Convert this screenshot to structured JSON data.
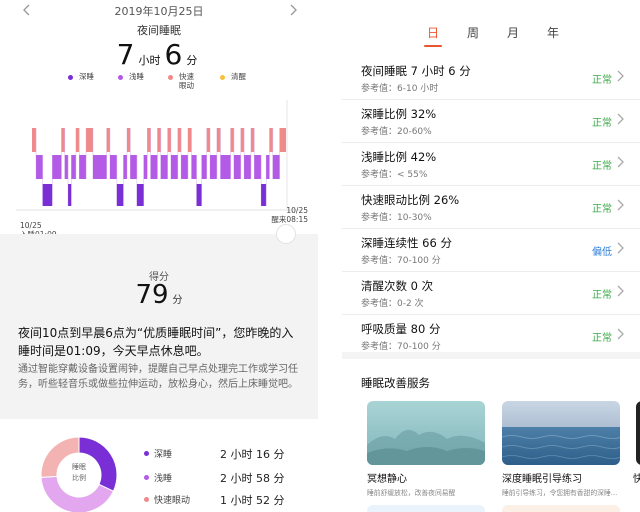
{
  "header": {
    "date": "2019年10月25日",
    "title": "夜间睡眠",
    "hours": "7",
    "hours_unit": "小时",
    "minutes": "6",
    "minutes_unit": "分"
  },
  "legend": [
    {
      "label": "深睡",
      "color": "#7a2fd6"
    },
    {
      "label": "浅睡",
      "color": "#b35ae6"
    },
    {
      "label": "快速\n眼动",
      "color": "#f08a8a"
    },
    {
      "label": "清醒",
      "color": "#f5c23a"
    }
  ],
  "chart_data": {
    "type": "area",
    "stages": [
      "快速眼动",
      "浅睡",
      "深睡"
    ],
    "colors": {
      "快速眼动": "#f08a8a",
      "浅睡": "#b35ae6",
      "深睡": "#7a2fd6"
    },
    "start_label": {
      "date": "10/25",
      "text": "入睡01:09"
    },
    "end_label": {
      "date": "10/25",
      "text": "醒来08:15"
    },
    "segments": [
      [
        "快速眼动",
        0.0,
        1.6
      ],
      [
        "浅睡",
        1.6,
        4.2
      ],
      [
        "深睡",
        4.2,
        8.0
      ],
      [
        "浅睡",
        8.0,
        11.6
      ],
      [
        "快速眼动",
        11.6,
        12.9
      ],
      [
        "浅睡",
        12.9,
        14.2
      ],
      [
        "深睡",
        14.2,
        15.5
      ],
      [
        "浅睡",
        15.5,
        17.3
      ],
      [
        "快速眼动",
        17.3,
        18.6
      ],
      [
        "浅睡",
        18.6,
        21.3
      ],
      [
        "快速眼动",
        21.3,
        24.0
      ],
      [
        "浅睡",
        24.0,
        29.4
      ],
      [
        "快速眼动",
        29.4,
        30.7
      ],
      [
        "浅睡",
        30.7,
        33.4
      ],
      [
        "深睡",
        33.4,
        36.0
      ],
      [
        "浅睡",
        36.0,
        37.4
      ],
      [
        "快速眼动",
        37.4,
        38.7
      ],
      [
        "浅睡",
        38.7,
        41.3
      ],
      [
        "深睡",
        41.3,
        44.0
      ],
      [
        "浅睡",
        44.0,
        45.4
      ],
      [
        "快速眼动",
        45.4,
        46.7
      ],
      [
        "浅睡",
        46.7,
        49.4
      ],
      [
        "快速眼动",
        49.4,
        50.7
      ],
      [
        "浅睡",
        50.7,
        53.4
      ],
      [
        "快速眼动",
        53.4,
        54.7
      ],
      [
        "浅睡",
        54.7,
        57.4
      ],
      [
        "快速眼动",
        57.4,
        58.7
      ],
      [
        "浅睡",
        58.7,
        61.4
      ],
      [
        "快速眼动",
        61.4,
        62.8
      ],
      [
        "浅睡",
        62.8,
        64.8
      ],
      [
        "深睡",
        64.8,
        66.8
      ],
      [
        "浅睡",
        66.8,
        68.8
      ],
      [
        "快速眼动",
        68.8,
        70.1
      ],
      [
        "浅睡",
        70.1,
        72.8
      ],
      [
        "快速眼动",
        72.8,
        74.2
      ],
      [
        "浅睡",
        74.2,
        78.2
      ],
      [
        "快速眼动",
        78.2,
        79.5
      ],
      [
        "浅睡",
        79.5,
        82.2
      ],
      [
        "快速眼动",
        82.2,
        83.5
      ],
      [
        "浅睡",
        83.5,
        86.2
      ],
      [
        "快速眼动",
        86.2,
        87.5
      ],
      [
        "浅睡",
        87.5,
        90.2
      ],
      [
        "深睡",
        90.2,
        92.2
      ],
      [
        "浅睡",
        92.2,
        93.5
      ],
      [
        "快速眼动",
        93.5,
        94.8
      ],
      [
        "浅睡",
        94.8,
        97.5
      ],
      [
        "快速眼动",
        97.5,
        100.0
      ]
    ]
  },
  "score": {
    "label": "得分",
    "value": "79",
    "unit": "分",
    "advice_main": "夜间10点到早晨6点为“优质睡眠时间”，您昨晚的入睡时间是01:09，今天早点休息吧。",
    "advice_sub": "通过智能穿戴设备设置闹钟，提醒自己早点处理完工作或学习任务，听些轻音乐或做些拉伸运动，放松身心，然后上床睡觉吧。"
  },
  "ring": {
    "center_line1": "睡眠",
    "center_line2": "比例",
    "slices": [
      {
        "name": "深睡",
        "percent": 32,
        "color": "#7a2fd6"
      },
      {
        "name": "浅睡",
        "percent": 42,
        "color": "#e2a7ee"
      },
      {
        "name": "快速眼动",
        "percent": 26,
        "color": "#f3b3b3"
      }
    ],
    "rows": [
      {
        "name": "深睡",
        "duration": "2 小时 16 分",
        "color": "#7a2fd6"
      },
      {
        "name": "浅睡",
        "duration": "2 小时 58 分",
        "color": "#b35ae6"
      },
      {
        "name": "快速眼动",
        "duration": "1 小时 52 分",
        "color": "#f08a8a"
      }
    ]
  },
  "tabs": [
    "日",
    "周",
    "月",
    "年"
  ],
  "active_tab": 0,
  "metrics": [
    {
      "title": "夜间睡眠  7 小时 6 分",
      "ref": "参考值：6-10 小时",
      "status": "正常",
      "status_color": "#3daa4a"
    },
    {
      "title": "深睡比例  32%",
      "ref": "参考值：20-60%",
      "status": "正常",
      "status_color": "#3daa4a"
    },
    {
      "title": "浅睡比例  42%",
      "ref": "参考值：< 55%",
      "status": "正常",
      "status_color": "#3daa4a"
    },
    {
      "title": "快速眼动比例  26%",
      "ref": "参考值：10-30%",
      "status": "正常",
      "status_color": "#3daa4a"
    },
    {
      "title": "深睡连续性  66 分",
      "ref": "参考值：70-100 分",
      "status": "偏低",
      "status_color": "#2f7fd8"
    },
    {
      "title": "清醒次数  0 次",
      "ref": "参考值：0-2 次",
      "status": "正常",
      "status_color": "#3daa4a"
    },
    {
      "title": "呼吸质量  80 分",
      "ref": "参考值：70-100 分",
      "status": "正常",
      "status_color": "#3daa4a"
    }
  ],
  "services": {
    "title": "睡眠改善服务",
    "cards": [
      {
        "name": "冥想静心",
        "desc": "睡前舒缓放松，改善夜间易醒"
      },
      {
        "name": "深度睡眠引导练习",
        "desc": "睡前引导练习，令您拥有香甜的深睡..."
      }
    ],
    "peek_name": "快"
  }
}
